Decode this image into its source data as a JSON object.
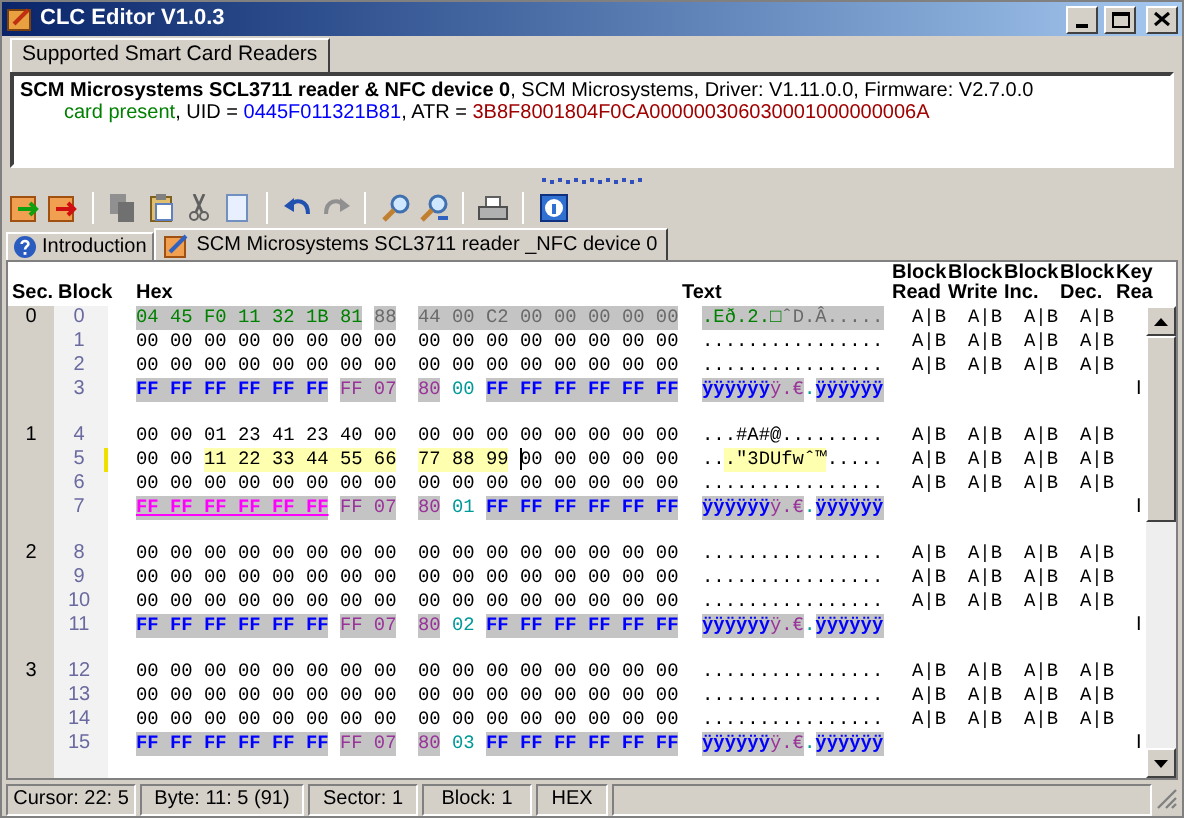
{
  "window": {
    "title": "CLC Editor V1.0.3"
  },
  "reader_tabs": [
    {
      "label": "Supported Smart Card Readers",
      "selected": true
    }
  ],
  "reader_info": {
    "lines": [
      [
        {
          "text": "SCM Microsystems SCL3711 reader & NFC device 0",
          "kind": "name"
        },
        {
          "text": ", SCM Microsystems, Driver: V1.11.0.0, Firmware: V2.7.0.0",
          "kind": "plain"
        }
      ],
      [
        {
          "text": "card present",
          "kind": "status"
        },
        {
          "text": ", UID = ",
          "kind": "plain"
        },
        {
          "text": "0445F011321B81",
          "kind": "uid"
        },
        {
          "text": ", ATR = ",
          "kind": "plain"
        },
        {
          "text": "3B8F8001804F0CA000000306030001000000006A",
          "kind": "atr"
        }
      ]
    ]
  },
  "doc_tabs": [
    {
      "label": "Introduction",
      "kind": "help",
      "selected": false
    },
    {
      "label": "SCM Microsystems SCL3711 reader _NFC device 0",
      "kind": "card",
      "selected": true
    }
  ],
  "grid": {
    "columns": [
      "Sec.",
      "Block",
      "Hex",
      "Text",
      "Block Read",
      "Block Write",
      "Block Inc.",
      "Block Dec.",
      "Key Rea"
    ],
    "sectors": [
      {
        "sec": "0",
        "blocks": [
          {
            "block": "0",
            "marked": false,
            "hex": [
              [
                {
                  "bytes": "04 45 F0 11 32 1B 81",
                  "kind": "uid"
                },
                {
                  "bytes": "88",
                  "kind": "bcc"
                }
              ],
              [
                {
                  "bytes": "44 00 C2 00 00 00 00 00",
                  "kind": "manufacturer"
                }
              ]
            ],
            "text": [
              {
                "chars": ".Eð.2.□",
                "kind": "uid"
              },
              {
                "chars": "ˆ",
                "kind": "bcc"
              },
              {
                "chars": "D.Â.....",
                "kind": "manufacturer"
              }
            ],
            "access": [
              "A|B",
              "A|B",
              "A|B",
              "A|B"
            ]
          },
          {
            "block": "1",
            "marked": false,
            "hex": [
              [
                {
                  "bytes": "00 00 00 00 00 00 00 00",
                  "kind": "data"
                }
              ],
              [
                {
                  "bytes": "00 00 00 00 00 00 00 00",
                  "kind": "data"
                }
              ]
            ],
            "text": [
              {
                "chars": "................",
                "kind": "data"
              }
            ],
            "access": [
              "A|B",
              "A|B",
              "A|B",
              "A|B"
            ]
          },
          {
            "block": "2",
            "marked": false,
            "hex": [
              [
                {
                  "bytes": "00 00 00 00 00 00 00 00",
                  "kind": "data"
                }
              ],
              [
                {
                  "bytes": "00 00 00 00 00 00 00 00",
                  "kind": "data"
                }
              ]
            ],
            "text": [
              {
                "chars": "................",
                "kind": "data"
              }
            ],
            "access": [
              "A|B",
              "A|B",
              "A|B",
              "A|B"
            ]
          },
          {
            "block": "3",
            "marked": false,
            "hex": [
              [
                {
                  "bytes": "FF FF FF FF FF FF",
                  "kind": "key_a"
                },
                {
                  "bytes": "FF 07",
                  "kind": "access"
                }
              ],
              [
                {
                  "bytes": "80",
                  "kind": "access"
                },
                {
                  "bytes": "00",
                  "kind": "user"
                },
                {
                  "bytes": "FF FF FF FF FF FF",
                  "kind": "key_b"
                }
              ]
            ],
            "text": [
              {
                "chars": "ÿÿÿÿÿÿ",
                "kind": "key_a"
              },
              {
                "chars": "ÿ.€",
                "kind": "access"
              },
              {
                "chars": ".",
                "kind": "user"
              },
              {
                "chars": "ÿÿÿÿÿÿ",
                "kind": "key_b"
              }
            ],
            "key_read": "I"
          }
        ]
      },
      {
        "sec": "1",
        "blocks": [
          {
            "block": "4",
            "marked": false,
            "hex": [
              [
                {
                  "bytes": "00 00 01 23 41 23 40 00",
                  "kind": "data"
                }
              ],
              [
                {
                  "bytes": "00 00 00 00 00 00 00 00",
                  "kind": "data"
                }
              ]
            ],
            "text": [
              {
                "chars": "...#A#@.........",
                "kind": "data"
              }
            ],
            "access": [
              "A|B",
              "A|B",
              "A|B",
              "A|B"
            ]
          },
          {
            "block": "5",
            "marked": true,
            "hex": [
              [
                {
                  "bytes": "00 00",
                  "kind": "data",
                  "cursor": false
                },
                {
                  "bytes": "11 22 33 44 55 66",
                  "kind": "selected",
                  "cursor": false
                }
              ],
              [
                {
                  "bytes": "77 88 99",
                  "kind": "selected",
                  "cursor": false
                },
                {
                  "bytes": "00 00 00 00 00",
                  "kind": "data",
                  "cursor": true
                }
              ]
            ],
            "text": [
              {
                "chars": "..",
                "kind": "data"
              },
              {
                "chars": ".\"3DUfwˆ™",
                "kind": "selected"
              },
              {
                "chars": ".....",
                "kind": "data"
              }
            ],
            "access": [
              "A|B",
              "A|B",
              "A|B",
              "A|B"
            ]
          },
          {
            "block": "6",
            "marked": false,
            "hex": [
              [
                {
                  "bytes": "00 00 00 00 00 00 00 00",
                  "kind": "data"
                }
              ],
              [
                {
                  "bytes": "00 00 00 00 00 00 00 00",
                  "kind": "data"
                }
              ]
            ],
            "text": [
              {
                "chars": "................",
                "kind": "data"
              }
            ],
            "access": [
              "A|B",
              "A|B",
              "A|B",
              "A|B"
            ]
          },
          {
            "block": "7",
            "marked": false,
            "hex": [
              [
                {
                  "bytes": "FF FF FF FF FF FF",
                  "kind": "key_a_focus"
                },
                {
                  "bytes": "FF 07",
                  "kind": "access"
                }
              ],
              [
                {
                  "bytes": "80",
                  "kind": "access"
                },
                {
                  "bytes": "01",
                  "kind": "user"
                },
                {
                  "bytes": "FF FF FF FF FF FF",
                  "kind": "key_b"
                }
              ]
            ],
            "text": [
              {
                "chars": "ÿÿÿÿÿÿ",
                "kind": "key_a"
              },
              {
                "chars": "ÿ.€",
                "kind": "access"
              },
              {
                "chars": ".",
                "kind": "user"
              },
              {
                "chars": "ÿÿÿÿÿÿ",
                "kind": "key_b"
              }
            ],
            "key_read": "I"
          }
        ]
      },
      {
        "sec": "2",
        "blocks": [
          {
            "block": "8",
            "marked": false,
            "hex": [
              [
                {
                  "bytes": "00 00 00 00 00 00 00 00",
                  "kind": "data"
                }
              ],
              [
                {
                  "bytes": "00 00 00 00 00 00 00 00",
                  "kind": "data"
                }
              ]
            ],
            "text": [
              {
                "chars": "................",
                "kind": "data"
              }
            ],
            "access": [
              "A|B",
              "A|B",
              "A|B",
              "A|B"
            ]
          },
          {
            "block": "9",
            "marked": false,
            "hex": [
              [
                {
                  "bytes": "00 00 00 00 00 00 00 00",
                  "kind": "data"
                }
              ],
              [
                {
                  "bytes": "00 00 00 00 00 00 00 00",
                  "kind": "data"
                }
              ]
            ],
            "text": [
              {
                "chars": "................",
                "kind": "data"
              }
            ],
            "access": [
              "A|B",
              "A|B",
              "A|B",
              "A|B"
            ]
          },
          {
            "block": "10",
            "marked": false,
            "hex": [
              [
                {
                  "bytes": "00 00 00 00 00 00 00 00",
                  "kind": "data"
                }
              ],
              [
                {
                  "bytes": "00 00 00 00 00 00 00 00",
                  "kind": "data"
                }
              ]
            ],
            "text": [
              {
                "chars": "................",
                "kind": "data"
              }
            ],
            "access": [
              "A|B",
              "A|B",
              "A|B",
              "A|B"
            ]
          },
          {
            "block": "11",
            "marked": false,
            "hex": [
              [
                {
                  "bytes": "FF FF FF FF FF FF",
                  "kind": "key_a"
                },
                {
                  "bytes": "FF 07",
                  "kind": "access"
                }
              ],
              [
                {
                  "bytes": "80",
                  "kind": "access"
                },
                {
                  "bytes": "02",
                  "kind": "user"
                },
                {
                  "bytes": "FF FF FF FF FF FF",
                  "kind": "key_b"
                }
              ]
            ],
            "text": [
              {
                "chars": "ÿÿÿÿÿÿ",
                "kind": "key_a"
              },
              {
                "chars": "ÿ.€",
                "kind": "access"
              },
              {
                "chars": ".",
                "kind": "user"
              },
              {
                "chars": "ÿÿÿÿÿÿ",
                "kind": "key_b"
              }
            ],
            "key_read": "I"
          }
        ]
      },
      {
        "sec": "3",
        "blocks": [
          {
            "block": "12",
            "marked": false,
            "hex": [
              [
                {
                  "bytes": "00 00 00 00 00 00 00 00",
                  "kind": "data"
                }
              ],
              [
                {
                  "bytes": "00 00 00 00 00 00 00 00",
                  "kind": "data"
                }
              ]
            ],
            "text": [
              {
                "chars": "................",
                "kind": "data"
              }
            ],
            "access": [
              "A|B",
              "A|B",
              "A|B",
              "A|B"
            ]
          },
          {
            "block": "13",
            "marked": false,
            "hex": [
              [
                {
                  "bytes": "00 00 00 00 00 00 00 00",
                  "kind": "data"
                }
              ],
              [
                {
                  "bytes": "00 00 00 00 00 00 00 00",
                  "kind": "data"
                }
              ]
            ],
            "text": [
              {
                "chars": "................",
                "kind": "data"
              }
            ],
            "access": [
              "A|B",
              "A|B",
              "A|B",
              "A|B"
            ]
          },
          {
            "block": "14",
            "marked": false,
            "hex": [
              [
                {
                  "bytes": "00 00 00 00 00 00 00 00",
                  "kind": "data"
                }
              ],
              [
                {
                  "bytes": "00 00 00 00 00 00 00 00",
                  "kind": "data"
                }
              ]
            ],
            "text": [
              {
                "chars": "................",
                "kind": "data"
              }
            ],
            "access": [
              "A|B",
              "A|B",
              "A|B",
              "A|B"
            ]
          },
          {
            "block": "15",
            "marked": false,
            "hex": [
              [
                {
                  "bytes": "FF FF FF FF FF FF",
                  "kind": "key_a"
                },
                {
                  "bytes": "FF 07",
                  "kind": "access"
                }
              ],
              [
                {
                  "bytes": "80",
                  "kind": "access"
                },
                {
                  "bytes": "03",
                  "kind": "user"
                },
                {
                  "bytes": "FF FF FF FF FF FF",
                  "kind": "key_b"
                }
              ]
            ],
            "text": [
              {
                "chars": "ÿÿÿÿÿÿ",
                "kind": "key_a"
              },
              {
                "chars": "ÿ.€",
                "kind": "access"
              },
              {
                "chars": ".",
                "kind": "user"
              },
              {
                "chars": "ÿÿÿÿÿÿ",
                "kind": "key_b"
              }
            ],
            "key_read": "I"
          }
        ]
      }
    ]
  },
  "status_bar": [
    "Cursor: 22: 5",
    "Byte: 11: 5 (91)",
    "Sector: 1",
    "Block: 1",
    "HEX"
  ]
}
